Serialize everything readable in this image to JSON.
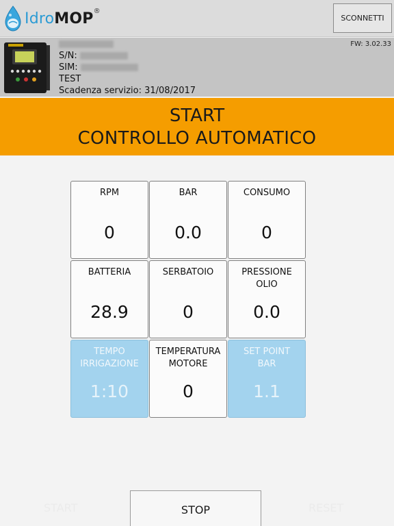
{
  "header": {
    "logo_idro": "Idro",
    "logo_mop": "MOP",
    "logo_mark": "®",
    "connect_label": "SCONNETTI"
  },
  "device": {
    "sn_label": "S/N:",
    "sim_label": "SIM:",
    "group": "TEST",
    "service_expiry": "Scadenza servizio: 31/08/2017",
    "firmware": "FW: 3.02.33"
  },
  "banner": {
    "line1": "START",
    "line2": "CONTROLLO AUTOMATICO",
    "color": "#f59d00"
  },
  "tiles": [
    {
      "label": "RPM",
      "value": "0"
    },
    {
      "label": "BAR",
      "value": "0.0"
    },
    {
      "label": "CONSUMO",
      "value": "0"
    },
    {
      "label": "BATTERIA",
      "value": "28.9"
    },
    {
      "label": "SERBATOIO",
      "value": "0"
    },
    {
      "label": "PRESSIONE\nOLIO",
      "value": "0.0"
    },
    {
      "label": "TEMPO\nIRRIGAZIONE",
      "value": "1:10"
    },
    {
      "label": "TEMPERATURA\nMOTORE",
      "value": "0"
    },
    {
      "label": "SET POINT\nBAR",
      "value": "1.1"
    }
  ],
  "bottom": {
    "start_label": "START",
    "stop_label": "STOP",
    "reset_label": "RESET"
  },
  "colors": {
    "accent_orange": "#f59d00",
    "tile_blue": "#a3d3ee",
    "logo_blue": "#2b9bd4"
  }
}
